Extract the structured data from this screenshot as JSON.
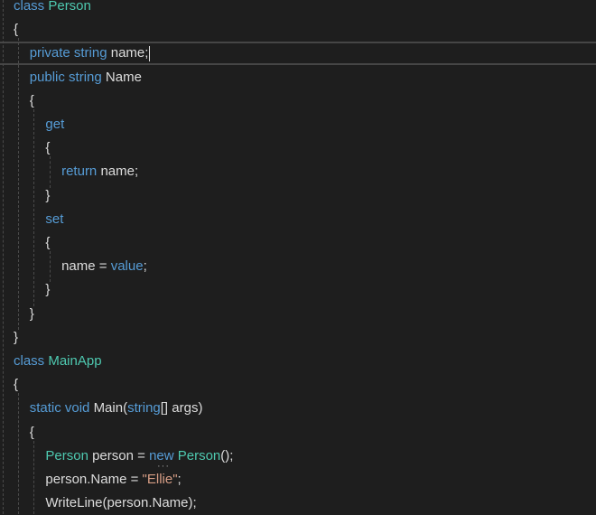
{
  "editor": {
    "lines": [
      [
        {
          "t": "class ",
          "c": "kw"
        },
        {
          "t": "Person",
          "c": "type"
        }
      ],
      [
        {
          "t": "{",
          "c": "plain"
        }
      ],
      [
        {
          "t": "private string ",
          "c": "kw"
        },
        {
          "t": "name;",
          "c": "plain"
        }
      ],
      [
        {
          "t": "public string ",
          "c": "kw"
        },
        {
          "t": "Name",
          "c": "plain"
        }
      ],
      [
        {
          "t": "{",
          "c": "plain"
        }
      ],
      [
        {
          "t": "get",
          "c": "kw"
        }
      ],
      [
        {
          "t": "{",
          "c": "plain"
        }
      ],
      [
        {
          "t": "return ",
          "c": "kw"
        },
        {
          "t": "name;",
          "c": "plain"
        }
      ],
      [
        {
          "t": "}",
          "c": "plain"
        }
      ],
      [
        {
          "t": "set",
          "c": "kw"
        }
      ],
      [
        {
          "t": "{",
          "c": "plain"
        }
      ],
      [
        {
          "t": "name = ",
          "c": "plain"
        },
        {
          "t": "value",
          "c": "kw"
        },
        {
          "t": ";",
          "c": "plain"
        }
      ],
      [
        {
          "t": "}",
          "c": "plain"
        }
      ],
      [
        {
          "t": "}",
          "c": "plain"
        }
      ],
      [
        {
          "t": "}",
          "c": "plain"
        }
      ],
      [
        {
          "t": "class ",
          "c": "kw"
        },
        {
          "t": "MainApp",
          "c": "type"
        }
      ],
      [
        {
          "t": "{",
          "c": "plain"
        }
      ],
      [
        {
          "t": "static void ",
          "c": "kw"
        },
        {
          "t": "Main(",
          "c": "plain"
        },
        {
          "t": "string",
          "c": "kw"
        },
        {
          "t": "[] args)",
          "c": "plain"
        }
      ],
      [
        {
          "t": "{",
          "c": "plain"
        }
      ],
      [
        {
          "t": "Person",
          "c": "type"
        },
        {
          "t": " person = ",
          "c": "plain"
        },
        {
          "t": "new ",
          "c": "kw"
        },
        {
          "t": "Person",
          "c": "type"
        },
        {
          "t": "();",
          "c": "plain"
        }
      ],
      [
        {
          "t": "person.Name = ",
          "c": "plain"
        },
        {
          "t": "\"Ellie\"",
          "c": "str"
        },
        {
          "t": ";",
          "c": "plain"
        }
      ],
      [
        {
          "t": "WriteLine(person.Name);",
          "c": "plain"
        }
      ]
    ]
  }
}
